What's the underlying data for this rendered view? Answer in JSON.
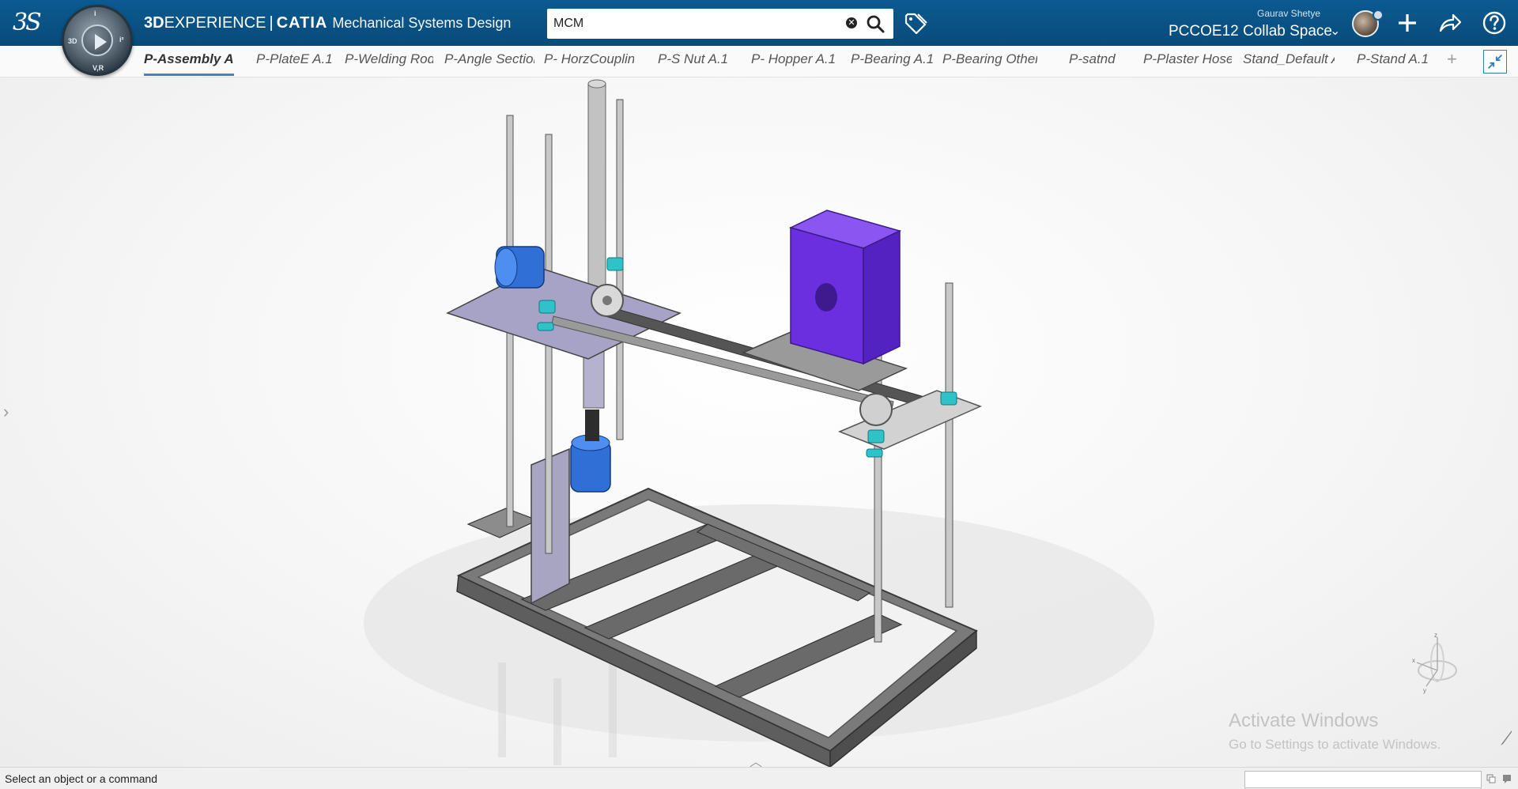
{
  "header": {
    "brand_3d": "3D",
    "brand_experience": "EXPERIENCE",
    "brand_sep": "|",
    "brand_catia": "CATIA",
    "brand_app": "Mechanical Systems Design",
    "compass_labels": {
      "top": "i",
      "left": "3D",
      "right": "i²",
      "bottom": "V,R"
    },
    "search": {
      "value": "MCM",
      "placeholder": "Search"
    },
    "user_name": "Gaurav Shetye",
    "collab_space": "PCCOE12 Collab Space",
    "accent_color": "#0b5a91"
  },
  "tabs": [
    {
      "label": "P-Assembly A.",
      "active": true
    },
    {
      "label": "P-PlateE A.1",
      "active": false
    },
    {
      "label": "P-Welding Rod",
      "active": false
    },
    {
      "label": "P-Angle Section",
      "active": false
    },
    {
      "label": "P- HorzCouplin",
      "active": false
    },
    {
      "label": "P-S Nut A.1",
      "active": false
    },
    {
      "label": "P- Hopper A.1",
      "active": false
    },
    {
      "label": "P-Bearing A.1",
      "active": false
    },
    {
      "label": "P-Bearing Other",
      "active": false
    },
    {
      "label": "P-satnd",
      "active": false
    },
    {
      "label": "P-Plaster Hose",
      "active": false
    },
    {
      "label": "Stand_Default A",
      "active": false
    },
    {
      "label": "P-Stand A.1",
      "active": false
    }
  ],
  "tab_add_label": "+",
  "viewport": {
    "triad_labels": {
      "x": "x",
      "y": "y",
      "z": "z"
    },
    "activation_title": "Activate Windows",
    "activation_subtitle": "Go to Settings to activate Windows.",
    "model_colors": {
      "frame": "#6f6f6f",
      "plate": "#a9a6c8",
      "motor": "#2f6fd6",
      "hopper": "#6e2ee0",
      "bearing": "#2fc2c8",
      "rod": "#bdbdbd"
    }
  },
  "status": {
    "message": "Select an object or a command",
    "command_value": ""
  }
}
